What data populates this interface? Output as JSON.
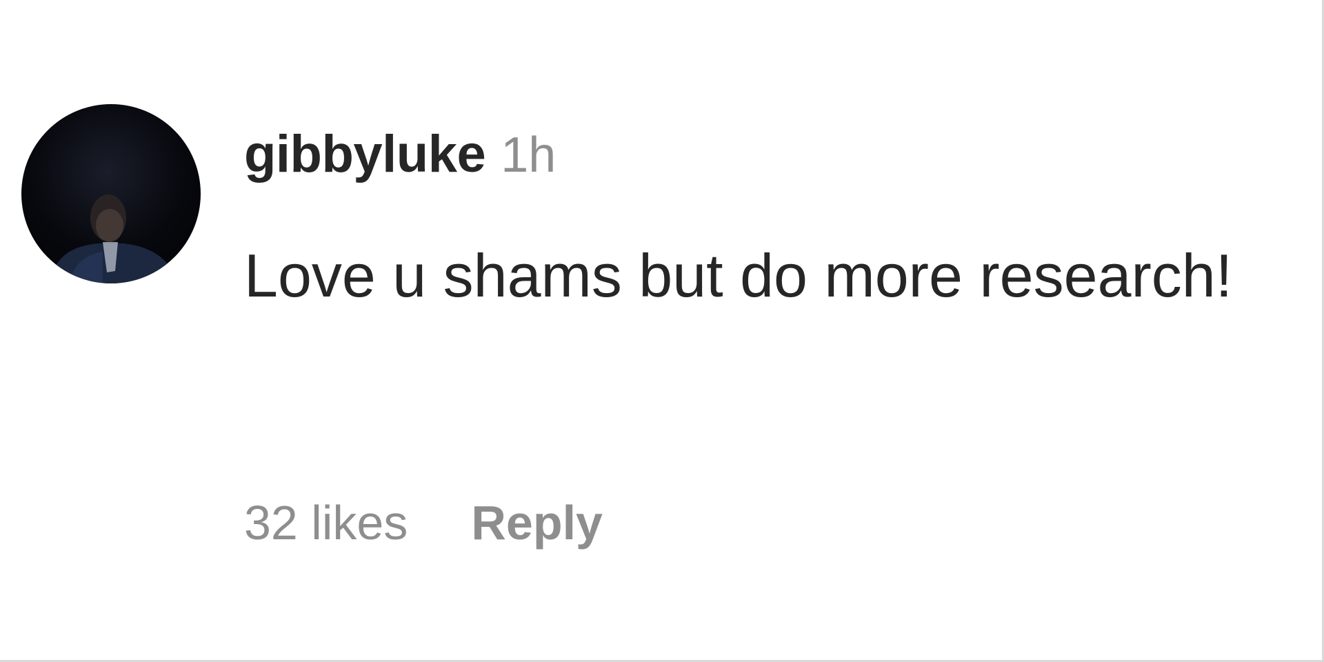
{
  "comment": {
    "username": "gibbyluke",
    "timestamp": "1h",
    "text": "Love u shams but do more research!",
    "likes_label": "32 likes",
    "reply_label": "Reply",
    "avatar_icon": "user-avatar-photo"
  },
  "colors": {
    "text_primary": "#262626",
    "text_secondary": "#8e8e8e",
    "avatar_shirt": "#1c2740"
  }
}
